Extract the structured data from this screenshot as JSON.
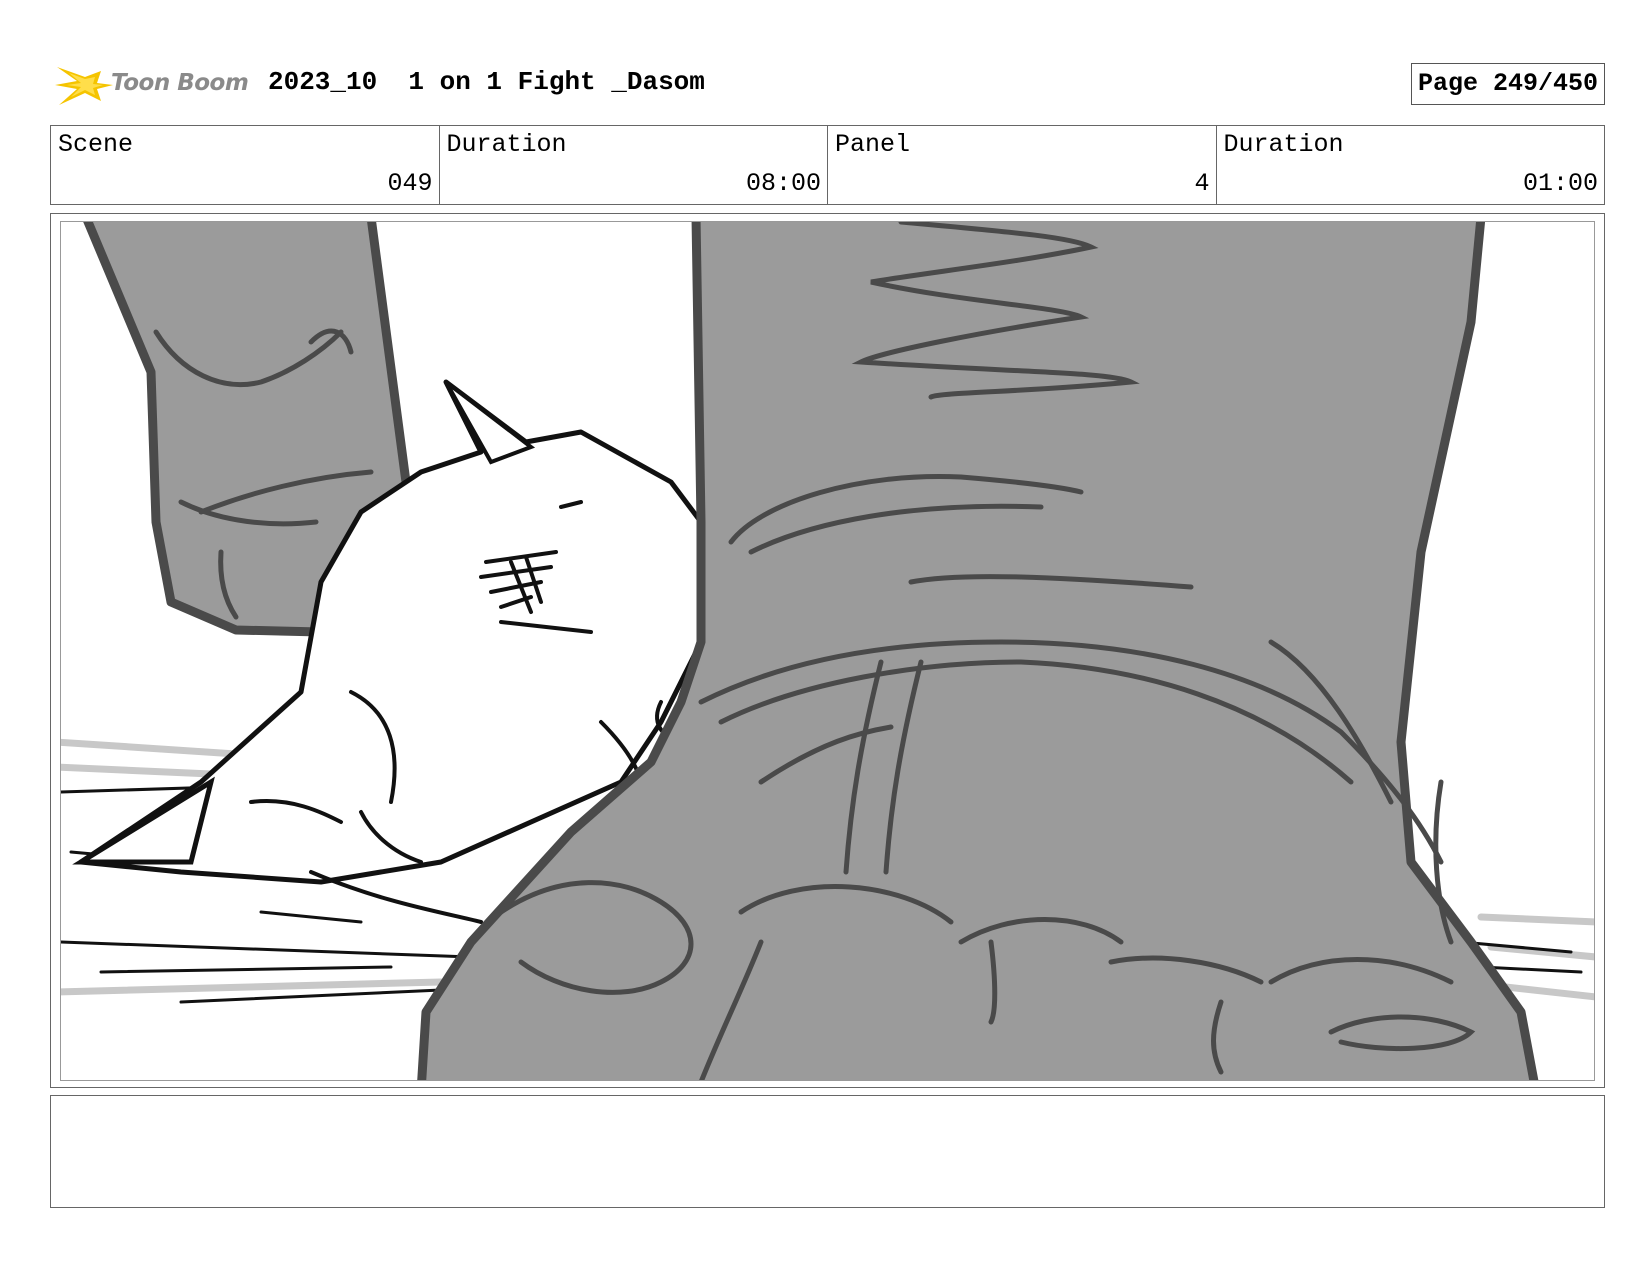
{
  "header": {
    "logo_text": "Toon Boom",
    "title": "2023_10  1 on 1 Fight _Dasom",
    "page": "Page 249/450"
  },
  "info": [
    {
      "label": "Scene",
      "value": "049"
    },
    {
      "label": "Duration",
      "value": "08:00"
    },
    {
      "label": "Panel",
      "value": "4"
    },
    {
      "label": "Duration",
      "value": "01:00"
    }
  ],
  "notes": "",
  "colors": {
    "sketch_gray_fill": "#9a9a9a",
    "sketch_gray_line": "#4a4a4a",
    "ink": "#000000",
    "logo_yellow": "#f5c400"
  }
}
